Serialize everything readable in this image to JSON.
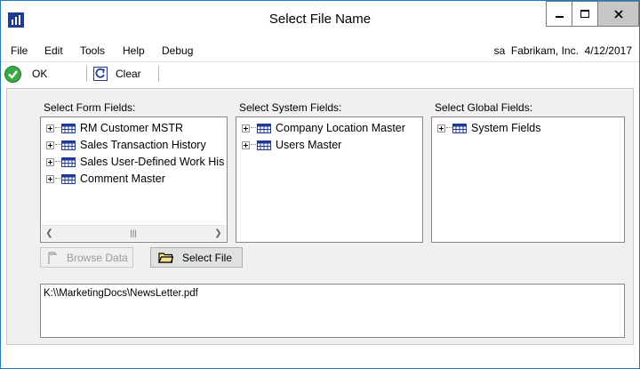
{
  "window": {
    "title": "Select File Name",
    "controls": {
      "minimize": "minimize-icon",
      "maximize": "maximize-icon",
      "close": "close-icon"
    }
  },
  "menu": {
    "items": [
      "File",
      "Edit",
      "Tools",
      "Help",
      "Debug"
    ],
    "context": "sa  Fabrikam, Inc.  4/12/2017"
  },
  "toolbar": {
    "ok_label": "OK",
    "clear_label": "Clear",
    "ok_icon": "checkmark-icon",
    "clear_icon": "clear-icon"
  },
  "form_fields": {
    "label": "Select Form Fields:",
    "items": [
      "RM Customer MSTR",
      "Sales Transaction History",
      "Sales User-Defined Work His",
      "Comment Master"
    ]
  },
  "system_fields": {
    "label": "Select System Fields:",
    "items": [
      "Company Location Master",
      "Users Master"
    ]
  },
  "global_fields": {
    "label": "Select Global Fields:",
    "items": [
      "System Fields"
    ]
  },
  "buttons": {
    "browse_data": "Browse Data",
    "select_file": "Select File"
  },
  "file_path": "K:\\\\MarketingDocs\\NewsLetter.pdf",
  "colors": {
    "accent": "#1979ca",
    "ok_green": "#3aa844",
    "content_bg": "#f0f0f0"
  }
}
